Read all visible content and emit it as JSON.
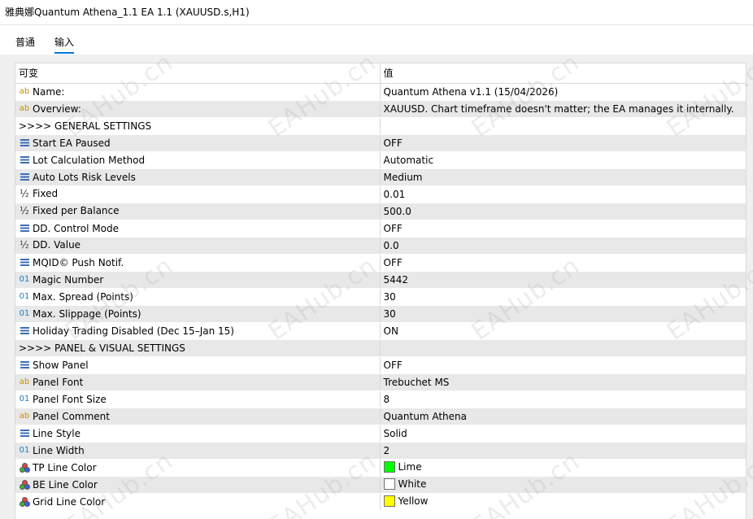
{
  "window": {
    "title": "雅典娜Quantum Athena_1.1 EA 1.1 (XAUUSD.s,H1)"
  },
  "tabs": [
    {
      "label": "普通",
      "active": false
    },
    {
      "label": "输入",
      "active": true
    }
  ],
  "table": {
    "headers": [
      "可变",
      "值"
    ],
    "rows": [
      {
        "icon": "ab",
        "name": "Name:",
        "value": "Quantum Athena v1.1 (15/04/2026)"
      },
      {
        "icon": "ab",
        "name": "Overview:",
        "value": "XAUUSD. Chart timeframe doesn't matter; the EA manages it internally."
      },
      {
        "icon": "",
        "name": ">>>> GENERAL SETTINGS",
        "value": ""
      },
      {
        "icon": "list",
        "name": "Start EA Paused",
        "value": "OFF"
      },
      {
        "icon": "list",
        "name": "Lot Calculation Method",
        "value": "Automatic"
      },
      {
        "icon": "list",
        "name": "Auto Lots Risk Levels",
        "value": "Medium"
      },
      {
        "icon": "half",
        "name": "Fixed",
        "value": "0.01"
      },
      {
        "icon": "half",
        "name": "Fixed per Balance",
        "value": "500.0"
      },
      {
        "icon": "list",
        "name": "DD. Control Mode",
        "value": "OFF"
      },
      {
        "icon": "half",
        "name": "DD. Value",
        "value": "0.0"
      },
      {
        "icon": "list",
        "name": "MQID© Push Notif.",
        "value": "OFF"
      },
      {
        "icon": "n01",
        "name": "Magic Number",
        "value": "5442"
      },
      {
        "icon": "n01",
        "name": "Max. Spread (Points)",
        "value": "30"
      },
      {
        "icon": "n01",
        "name": "Max. Slippage (Points)",
        "value": "30"
      },
      {
        "icon": "list",
        "name": "Holiday Trading Disabled (Dec 15–Jan 15)",
        "value": "ON"
      },
      {
        "icon": "",
        "name": ">>>> PANEL & VISUAL SETTINGS",
        "value": ""
      },
      {
        "icon": "list",
        "name": "Show Panel",
        "value": "OFF"
      },
      {
        "icon": "ab",
        "name": "Panel Font",
        "value": "Trebuchet MS"
      },
      {
        "icon": "n01",
        "name": "Panel Font Size",
        "value": "8"
      },
      {
        "icon": "ab",
        "name": "Panel Comment",
        "value": "Quantum Athena"
      },
      {
        "icon": "list",
        "name": "Line Style",
        "value": "Solid"
      },
      {
        "icon": "n01",
        "name": "Line Width",
        "value": "2"
      },
      {
        "icon": "color",
        "name": "TP Line Color",
        "value": "Lime",
        "swatch": "#00ff00"
      },
      {
        "icon": "color",
        "name": "BE Line Color",
        "value": "White",
        "swatch": "#ffffff"
      },
      {
        "icon": "color",
        "name": "Grid Line Color",
        "value": "Yellow",
        "swatch": "#ffff00"
      }
    ]
  },
  "icon_labels": {
    "ab": "ab",
    "n01": "01",
    "half": "½"
  },
  "icon_names": {
    "ab": "string-type-icon",
    "n01": "integer-type-icon",
    "half": "double-type-icon",
    "list": "enum-list-icon",
    "color": "color-type-icon"
  },
  "watermark": "EAHub.cn"
}
